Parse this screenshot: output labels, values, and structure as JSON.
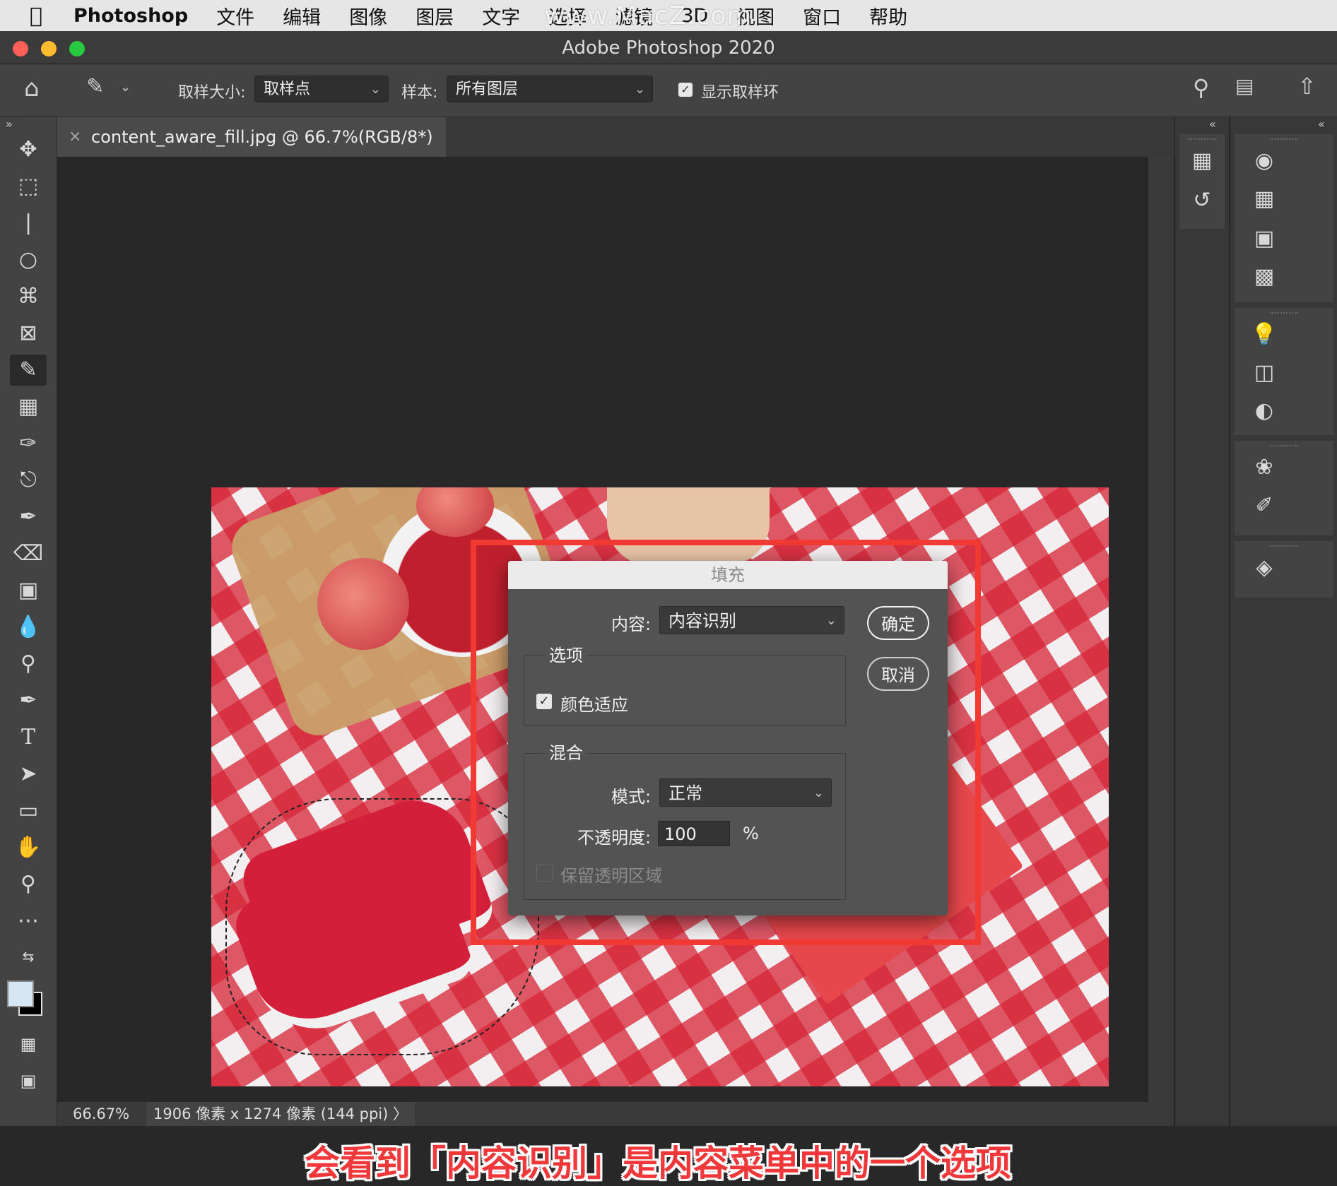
{
  "menubar": {
    "app": "Photoshop",
    "items": [
      "文件",
      "编辑",
      "图像",
      "图层",
      "文字",
      "选择",
      "滤镜",
      "3D",
      "视图",
      "窗口",
      "帮助"
    ]
  },
  "watermark": "www.MacZ.com",
  "window": {
    "title": "Adobe Photoshop 2020"
  },
  "options": {
    "sample_size_label": "取样大小:",
    "sample_size_value": "取样点",
    "sample_label": "样本:",
    "sample_value": "所有图层",
    "show_ring_label": "显示取样环",
    "show_ring_checked": true
  },
  "document": {
    "tab_title": "content_aware_fill.jpg @ 66.7%(RGB/8*) *"
  },
  "dialog": {
    "title": "填充",
    "content_label": "内容:",
    "content_value": "内容识别",
    "options_group": "选项",
    "color_adapt_label": "颜色适应",
    "color_adapt_checked": true,
    "blend_group": "混合",
    "mode_label": "模式:",
    "mode_value": "正常",
    "opacity_label": "不透明度:",
    "opacity_value": "100",
    "opacity_unit": "%",
    "preserve_label": "保留透明区域",
    "preserve_checked": false,
    "ok": "确定",
    "cancel": "取消"
  },
  "caption": "会看到「内容识别」是内容菜单中的一个选项",
  "status": {
    "zoom": "66.67%",
    "info": "1906 像素 x 1274 像素 (144 ppi)"
  },
  "colors": {
    "highlight": "#f23a35",
    "caption": "#f0373a"
  }
}
